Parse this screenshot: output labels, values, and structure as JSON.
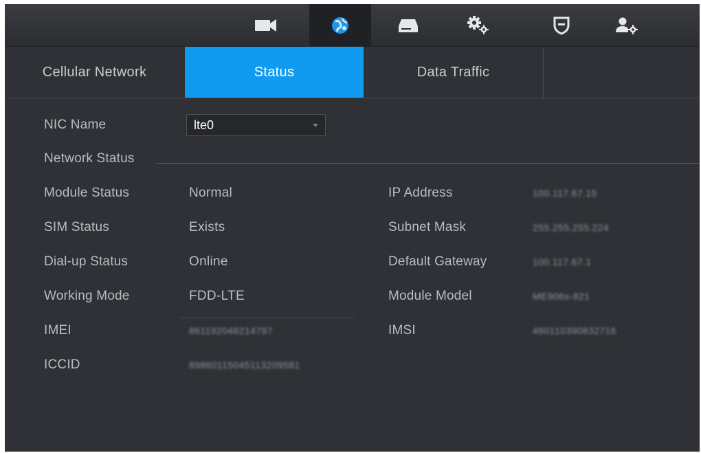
{
  "topbar": {
    "icons": [
      {
        "name": "camera-icon",
        "active": false
      },
      {
        "name": "network-icon",
        "active": true
      },
      {
        "name": "storage-icon",
        "active": false
      },
      {
        "name": "system-settings-icon",
        "active": false
      },
      {
        "name": "security-shield-icon",
        "active": false
      },
      {
        "name": "account-settings-icon",
        "active": false
      }
    ]
  },
  "tabs": {
    "cellular": "Cellular Network",
    "status": "Status",
    "traffic": "Data Traffic"
  },
  "nic": {
    "label": "NIC Name",
    "value": "lte0"
  },
  "section": {
    "title": "Network Status"
  },
  "left": {
    "module_status_label": "Module Status",
    "module_status_value": "Normal",
    "sim_status_label": "SIM Status",
    "sim_status_value": "Exists",
    "dialup_status_label": "Dial-up Status",
    "dialup_status_value": "Online",
    "working_mode_label": "Working Mode",
    "working_mode_value": "FDD-LTE",
    "imei_label": "IMEI",
    "imei_value": "861192048214797",
    "iccid_label": "ICCID",
    "iccid_value": "89860115045113209581"
  },
  "right": {
    "ip_label": "IP Address",
    "ip_value": "100.117.67.15",
    "subnet_label": "Subnet Mask",
    "subnet_value": "255.255.255.224",
    "gateway_label": "Default Gateway",
    "gateway_value": "100.117.67.1",
    "model_label": "Module Model",
    "model_value": "ME906s-821",
    "imsi_label": "IMSI",
    "imsi_value": "460110390832716"
  },
  "colors": {
    "accent": "#109bf0",
    "background": "#2f3136",
    "text": "#b9bcc1"
  }
}
